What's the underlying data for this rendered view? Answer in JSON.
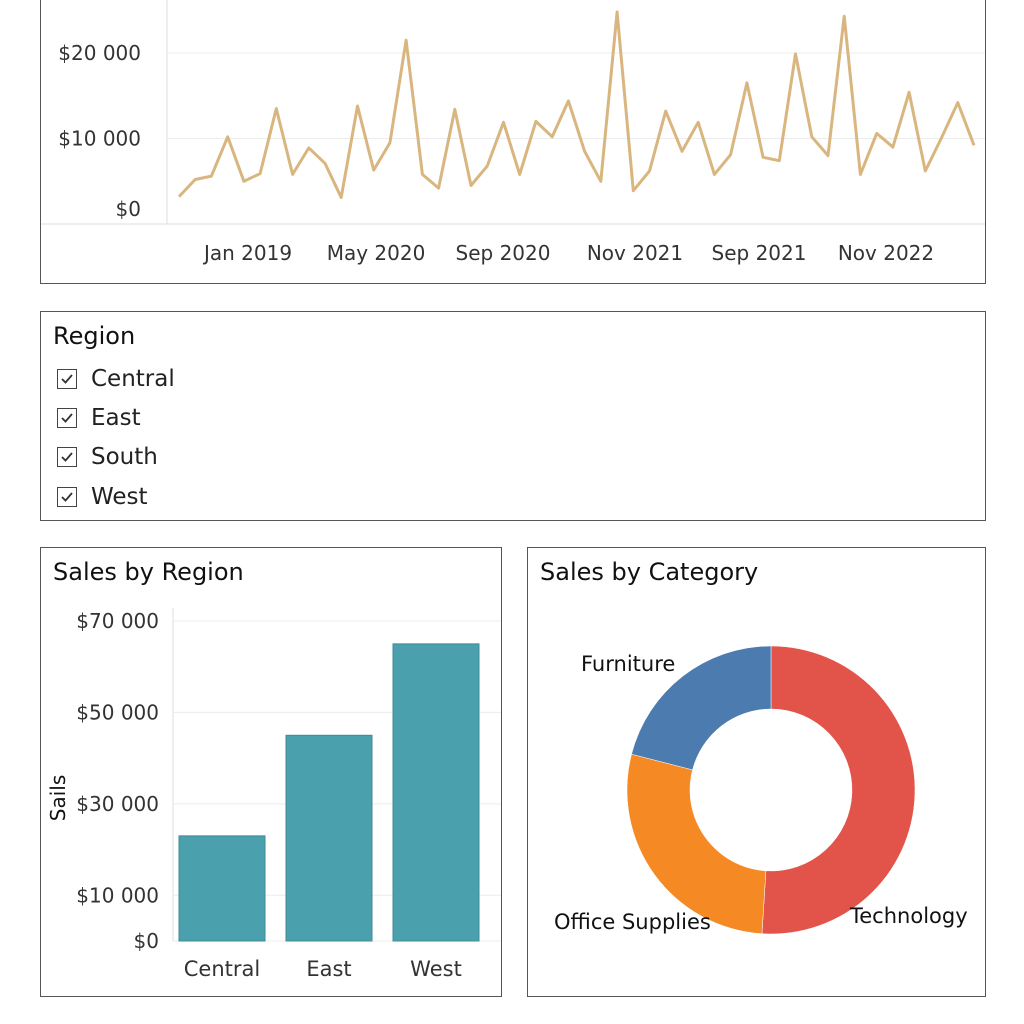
{
  "line_chart": {
    "chart_data": {
      "type": "line",
      "y_ticks": [
        "$20 000",
        "$10 000",
        "$0"
      ],
      "y_tick_values": [
        20000,
        10000,
        0
      ],
      "x_ticks": [
        "Jan 2019",
        "May 2020",
        "Sep 2020",
        "Nov 2021",
        "Sep 2021",
        "Nov 2022"
      ],
      "ylim": [
        0,
        25000
      ],
      "grid": true,
      "values": [
        3200,
        5200,
        5600,
        10200,
        5000,
        5900,
        13500,
        5800,
        8900,
        7100,
        3100,
        13800,
        6300,
        9500,
        21500,
        5800,
        4200,
        13400,
        4500,
        6800,
        11900,
        5800,
        12000,
        10200,
        14400,
        8500,
        5000,
        24800,
        3900,
        6200,
        13200,
        8500,
        11900,
        5800,
        8100,
        16500,
        7800,
        7400,
        19900,
        10200,
        8000,
        24300,
        5800,
        10600,
        9000,
        15400,
        6200,
        10100,
        14200,
        9200
      ],
      "color": "#d9b67f"
    }
  },
  "region_filter": {
    "title": "Region",
    "items": [
      {
        "label": "Central",
        "checked": true
      },
      {
        "label": "East",
        "checked": true
      },
      {
        "label": "South",
        "checked": true
      },
      {
        "label": "West",
        "checked": true
      }
    ]
  },
  "bar_chart": {
    "title": "Sales by Region",
    "chart_data": {
      "type": "bar",
      "categories": [
        "Central",
        "East",
        "West"
      ],
      "values": [
        23000,
        45000,
        65000
      ],
      "ylabel": "Sails",
      "ylim": [
        0,
        70000
      ],
      "y_ticks": [
        "$70 000",
        "$50 000",
        "$30 000",
        "$10 000",
        "$0"
      ],
      "y_tick_values": [
        70000,
        50000,
        30000,
        10000,
        0
      ],
      "color": "#4aa0ac",
      "grid": true
    }
  },
  "pie_chart": {
    "title": "Sales by Category",
    "chart_data": {
      "type": "pie",
      "categories": [
        "Technology",
        "Office Supplies",
        "Furniture"
      ],
      "values": [
        51,
        28,
        21
      ],
      "colors": [
        "#e2544a",
        "#f58a24",
        "#4c7baf"
      ]
    }
  }
}
